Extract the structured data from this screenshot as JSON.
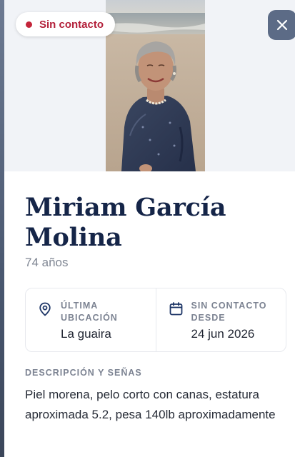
{
  "status": {
    "label": "Sin contacto",
    "color": "#c4253a"
  },
  "close": {
    "icon": "close-icon"
  },
  "person": {
    "name": "Miriam García Molina",
    "age": "74 años"
  },
  "last_location": {
    "label": "Última ubicación",
    "value": "La guaira",
    "icon": "location-pin-icon"
  },
  "no_contact_since": {
    "label": "Sin contacto desde",
    "value": "24 jun 2026",
    "icon": "calendar-icon"
  },
  "description": {
    "heading": "Descripción y señas",
    "text": "Piel morena, pelo corto con canas, estatura aproximada 5.2, pesa 140lb aproximadamente"
  },
  "colors": {
    "accent_navy": "#152548",
    "close_button": "#5c6b86",
    "alert_red": "#b3203a"
  }
}
